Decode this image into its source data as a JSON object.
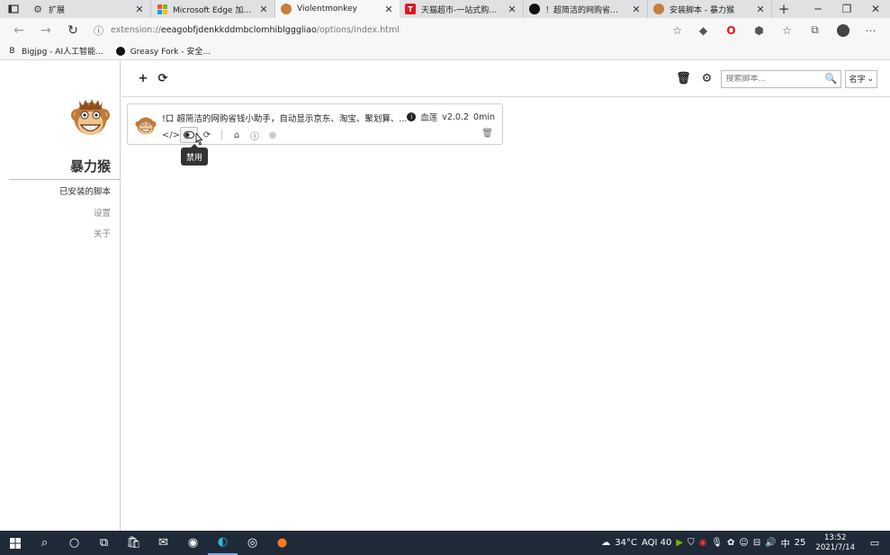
{
  "browser": {
    "tabs": [
      {
        "title": "扩展",
        "active": false
      },
      {
        "title": "Microsoft Edge 加载项 -",
        "active": false
      },
      {
        "title": "Violentmonkey",
        "active": true
      },
      {
        "title": "天猫超市-一站式购齐, 自",
        "active": false
      },
      {
        "title": "！超简洁的网购省钱小助手",
        "active": false
      },
      {
        "title": "安装脚本 - 暴力猴",
        "active": false
      }
    ],
    "url_protocol": "extension://",
    "url_host": "eeagobfjdenkkddmbclomhiblgggliao",
    "url_path": "/options/index.html",
    "bookmarks": [
      {
        "label": "Bigjpg - AI人工智能..."
      },
      {
        "label": "Greasy Fork - 安全..."
      }
    ]
  },
  "sidebar": {
    "brand": "暴力猴",
    "items": [
      {
        "label": "已安装的脚本",
        "active": true
      },
      {
        "label": "设置",
        "active": false
      },
      {
        "label": "关于",
        "active": false
      }
    ]
  },
  "toolbar": {
    "add_label": "+",
    "refresh_label": "⟳",
    "search_placeholder": "搜索脚本...",
    "sort_value": "名字"
  },
  "script": {
    "name": "!口 超简洁的网购省钱小助手，自动显示京东、淘宝、聚划算、...",
    "author": "血莲",
    "version": "v2.0.2",
    "updated": "0min"
  },
  "tooltip": {
    "text": "禁用"
  },
  "taskbar": {
    "weather": "34°C",
    "aqi": "AQI 40",
    "ime": "中",
    "badge": "25",
    "time": "13:52",
    "date": "2021/7/14"
  },
  "colors": {
    "accent": "#1f2a38",
    "tab_strip": "#dfe1e3",
    "active_tab": "#f7f7f7"
  }
}
